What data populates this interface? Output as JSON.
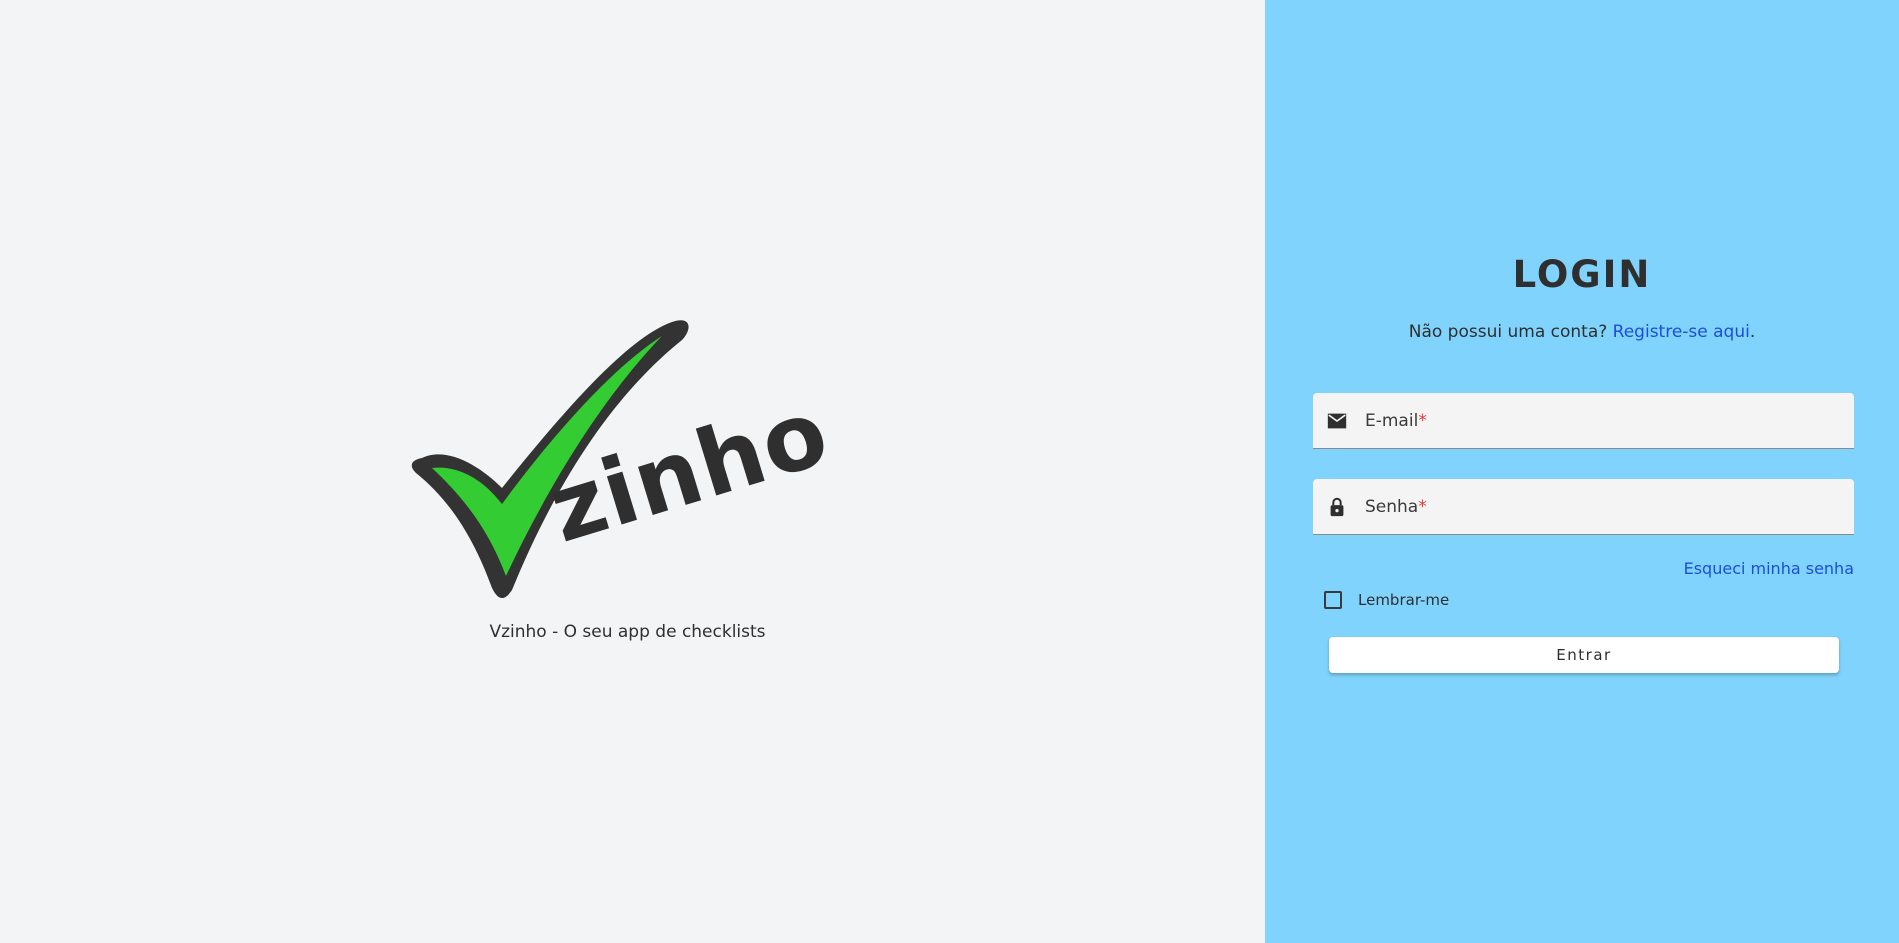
{
  "brand": {
    "logo_text": "Vzinho",
    "logo_word": "zinho",
    "tagline": "Vzinho - O seu app de checklists",
    "colors": {
      "check_fill": "#33cc33",
      "check_outline": "#333333"
    }
  },
  "login": {
    "title": "LOGIN",
    "register_prompt": "Não possui uma conta?",
    "register_link": "Registre-se aqui",
    "register_suffix": ".",
    "email": {
      "label": "E-mail",
      "required_mark": "*",
      "value": "",
      "icon": "mail-icon"
    },
    "password": {
      "label": "Senha",
      "required_mark": "*",
      "value": "",
      "icon": "lock-icon"
    },
    "forgot_link": "Esqueci minha senha",
    "remember_label": "Lembrar-me",
    "remember_checked": false,
    "submit_label": "Entrar"
  },
  "theme": {
    "left_bg": "#f3f4f6",
    "right_bg": "#7fd3fc",
    "link_color": "#1d4ed8",
    "required_color": "#e53935"
  }
}
